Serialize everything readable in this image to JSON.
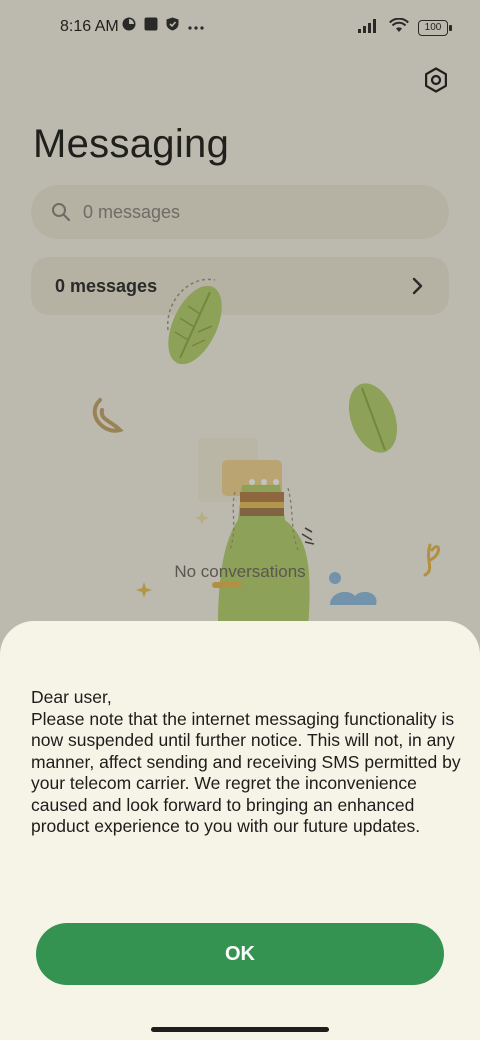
{
  "status_bar": {
    "time": "8:16 AM",
    "left_icons": [
      "app-status-icon",
      "square-notification-icon",
      "shield-icon",
      "more-dots-icon"
    ],
    "right_icons": [
      "signal-icon",
      "wifi-icon"
    ],
    "battery": "100"
  },
  "header": {
    "title": "Messaging",
    "settings_icon": "settings-gear-icon"
  },
  "search": {
    "placeholder": "0 messages"
  },
  "messages_row": {
    "label": "0 messages",
    "icon": "chevron-right-icon"
  },
  "empty_state": {
    "text": "No conversations"
  },
  "dialog": {
    "greeting": "Dear user,",
    "body": "Please note that the internet messaging functionality is now suspended until further notice. This will not, in any manner, affect sending and receiving SMS permitted by your telecom carrier. We regret the inconvenience caused and look forward to bringing an enhanced product experience to you with our future updates.",
    "ok_label": "OK",
    "accent_color": "#359352"
  }
}
